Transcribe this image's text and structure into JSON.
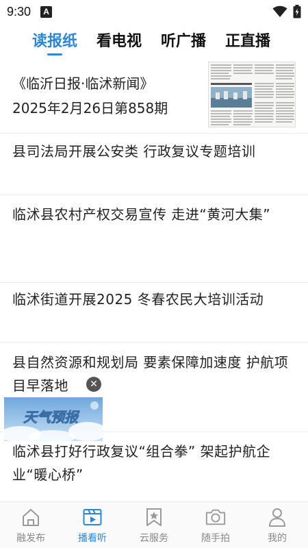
{
  "status": {
    "time": "9:30",
    "notif_letter": "A"
  },
  "tabs": [
    {
      "label": "读报纸",
      "active": true
    },
    {
      "label": "看电视",
      "active": false
    },
    {
      "label": "听广播",
      "active": false
    },
    {
      "label": "正直播",
      "active": false
    }
  ],
  "paper": {
    "title": "《临沂日报·临沭新闻》",
    "date": "2025年2月26日第858期"
  },
  "news": [
    {
      "title": "县司法局开展公安类  行政复议专题培训"
    },
    {
      "title": "临沭县农村产权交易宣传  走进“黄河大集”"
    },
    {
      "title": "临沭街道开展2025  冬春农民大培训活动"
    },
    {
      "title": "县自然资源和规划局  要素保障加速度  护航项目早落地"
    },
    {
      "title": "临沭县打好行政复议“组合拳”  架起护航企业“暖心桥”"
    }
  ],
  "weather_float": {
    "label": "天气预报"
  },
  "bottom_nav": [
    {
      "label": "融发布",
      "icon": "home-icon",
      "active": false
    },
    {
      "label": "播看听",
      "icon": "video-icon",
      "active": true
    },
    {
      "label": "云服务",
      "icon": "bookmark-star-icon",
      "active": false
    },
    {
      "label": "随手拍",
      "icon": "camera-icon",
      "active": false
    },
    {
      "label": "我的",
      "icon": "user-icon",
      "active": false
    }
  ],
  "colors": {
    "accent": "#2b86d6",
    "inactive": "#888888"
  }
}
